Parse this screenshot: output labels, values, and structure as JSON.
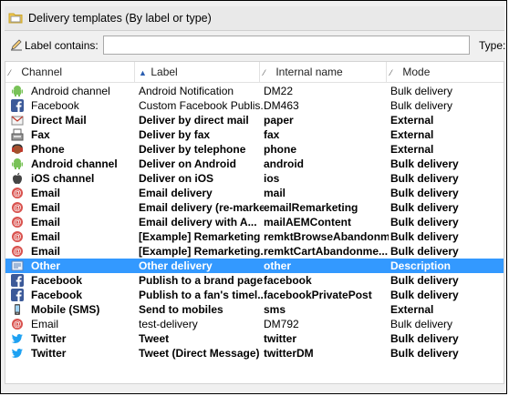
{
  "window": {
    "title": "Delivery templates (By label or type)"
  },
  "filter": {
    "label_caption": "Label contains:",
    "label_value": "",
    "type_caption": "Type:"
  },
  "columns": [
    "Channel",
    "Label",
    "Internal name",
    "Mode"
  ],
  "rows": [
    {
      "channel": "Android channel",
      "label": "Android Notification",
      "internal": "DM22",
      "mode": "Bulk delivery",
      "icon": "android-icon",
      "bold": false
    },
    {
      "channel": "Facebook",
      "label": "Custom Facebook Publis...",
      "internal": "DM463",
      "mode": "Bulk delivery",
      "icon": "facebook-icon",
      "bold": false
    },
    {
      "channel": "Direct Mail",
      "label": "Deliver by direct mail",
      "internal": "paper",
      "mode": "External",
      "icon": "direct-mail-icon",
      "bold": true
    },
    {
      "channel": "Fax",
      "label": "Deliver by fax",
      "internal": "fax",
      "mode": "External",
      "icon": "fax-icon",
      "bold": true
    },
    {
      "channel": "Phone",
      "label": "Deliver by telephone",
      "internal": "phone",
      "mode": "External",
      "icon": "phone-icon",
      "bold": true
    },
    {
      "channel": "Android channel",
      "label": "Deliver on Android",
      "internal": "android",
      "mode": "Bulk delivery",
      "icon": "android-icon",
      "bold": true
    },
    {
      "channel": "iOS channel",
      "label": "Deliver on iOS",
      "internal": "ios",
      "mode": "Bulk delivery",
      "icon": "apple-icon",
      "bold": true
    },
    {
      "channel": "Email",
      "label": "Email delivery",
      "internal": "mail",
      "mode": "Bulk delivery",
      "icon": "email-icon",
      "bold": true
    },
    {
      "channel": "Email",
      "label": "Email delivery (re-marke",
      "internal": "emailRemarketing",
      "mode": "Bulk delivery",
      "icon": "email-icon",
      "bold": true
    },
    {
      "channel": "Email",
      "label": "Email delivery with A...",
      "internal": "mailAEMContent",
      "mode": "Bulk delivery",
      "icon": "email-icon",
      "bold": true
    },
    {
      "channel": "Email",
      "label": "[Example] Remarketing .",
      "internal": "remktBrowseAbandonm",
      "mode": "Bulk delivery",
      "icon": "email-icon",
      "bold": true
    },
    {
      "channel": "Email",
      "label": "[Example] Remarketing..",
      "internal": "remktCartAbandonme...",
      "mode": "Bulk delivery",
      "icon": "email-icon",
      "bold": true
    },
    {
      "channel": "Other",
      "label": "Other delivery",
      "internal": "other",
      "mode": "Description",
      "icon": "other-channel-icon",
      "bold": true,
      "selected": true
    },
    {
      "channel": "Facebook",
      "label": "Publish to a brand page",
      "internal": "facebook",
      "mode": "Bulk delivery",
      "icon": "facebook-icon",
      "bold": true
    },
    {
      "channel": "Facebook",
      "label": "Publish to a fan's timel...",
      "internal": "facebookPrivatePost",
      "mode": "Bulk delivery",
      "icon": "facebook-icon",
      "bold": true
    },
    {
      "channel": "Mobile (SMS)",
      "label": "Send to mobiles",
      "internal": "sms",
      "mode": "External",
      "icon": "mobile-icon",
      "bold": true
    },
    {
      "channel": "Email",
      "label": "test-delivery",
      "internal": "DM792",
      "mode": "Bulk delivery",
      "icon": "email-icon",
      "bold": false
    },
    {
      "channel": "Twitter",
      "label": "Tweet",
      "internal": "twitter",
      "mode": "Bulk delivery",
      "icon": "twitter-icon",
      "bold": true
    },
    {
      "channel": "Twitter",
      "label": "Tweet (Direct Message)",
      "internal": "twitterDM",
      "mode": "Bulk delivery",
      "icon": "twitter-icon",
      "bold": true
    }
  ],
  "colors": {
    "selection": "#3399ff",
    "facebook": "#3b5998",
    "twitter": "#1da1f2",
    "android": "#78c257",
    "email": "#d9534f"
  }
}
